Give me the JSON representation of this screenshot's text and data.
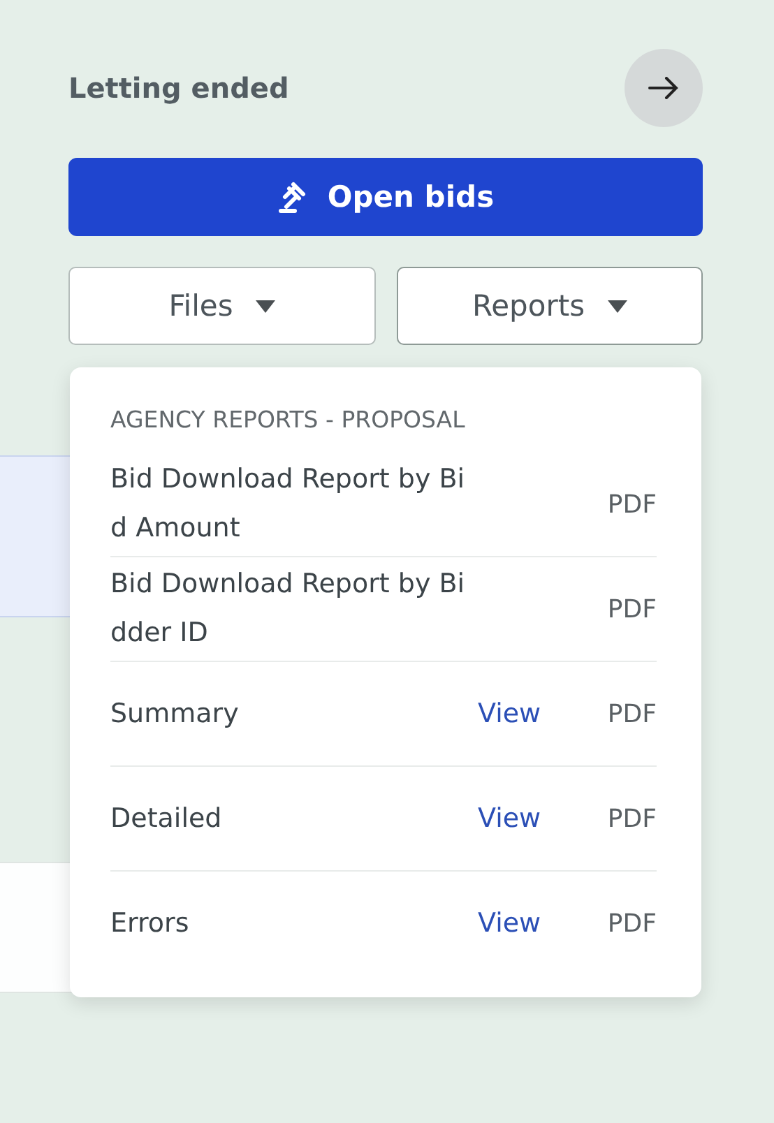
{
  "status": "Letting ended",
  "primary_button": {
    "label": "Open bids"
  },
  "dropdowns": [
    {
      "label": "Files",
      "expanded": false
    },
    {
      "label": "Reports",
      "expanded": true
    }
  ],
  "menu": {
    "heading": "AGENCY REPORTS - PROPOSAL",
    "items": [
      {
        "label_lines": [
          "Bid Download Report by Bi",
          "d Amount"
        ],
        "format": "PDF"
      },
      {
        "label_lines": [
          "Bid Download Report by Bi",
          "dder ID"
        ],
        "format": "PDF"
      },
      {
        "label_lines": [
          "Summary"
        ],
        "view": "View",
        "format": "PDF"
      },
      {
        "label_lines": [
          "Detailed"
        ],
        "view": "View",
        "format": "PDF"
      },
      {
        "label_lines": [
          "Errors"
        ],
        "view": "View",
        "format": "PDF"
      }
    ]
  }
}
